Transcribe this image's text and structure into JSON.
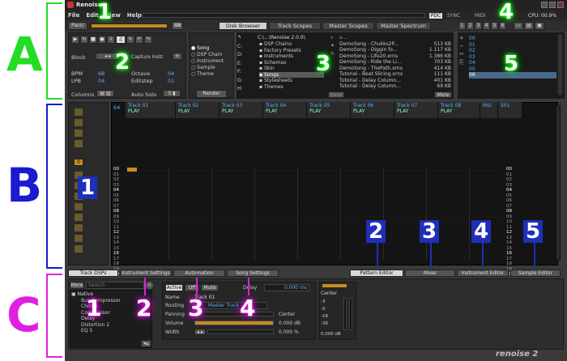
{
  "app": {
    "title": "Renoise",
    "logo": "renoise 2"
  },
  "menu": [
    "File",
    "Edit",
    "View",
    "Help"
  ],
  "status": {
    "pdc": "PDC",
    "sync": "SYNC",
    "midi": "MIDI",
    "cpu": "CPU: 00.9%"
  },
  "toolbar": {
    "panic": "Panic"
  },
  "upper_tabs": [
    "Disk Browser",
    "Track Scopes",
    "Master Scopes",
    "Master Spectrum"
  ],
  "upper_tab_active": "Disk Browser",
  "layout_buttons": [
    "1",
    "2",
    "3",
    "4",
    "5",
    "6"
  ],
  "transport": {
    "block": "Block",
    "capture": "Capture Instr.",
    "bpm_label": "BPM",
    "bpm": "68",
    "lpb_label": "LPB",
    "lpb": "04",
    "octave_label": "Octave",
    "octave": "04",
    "editstep_label": "Editstep",
    "editstep": "01",
    "columns": "Columns",
    "autosolo": "Auto Solo"
  },
  "render": {
    "options": [
      "Song",
      "DSP Chain",
      "Instrument",
      "Sample",
      "Theme"
    ],
    "selected": "Song",
    "button": "Render"
  },
  "browser": {
    "drives": [
      "C:",
      "D:",
      "E:",
      "F:",
      "G:",
      "H:"
    ],
    "path": "C:\\...\\Renoise 2.0.0\\",
    "folders": [
      "DSP Chains",
      "Factory Presets",
      "Instruments",
      "Schemas",
      "Skin",
      "Songs",
      "Stylesheets",
      "Themes"
    ],
    "selected_folder": "Songs",
    "files": [
      {
        "name": "..",
        "size": ""
      },
      {
        "name": "DemoSong - Chukks2P...",
        "size": "513 KB"
      },
      {
        "name": "DemoSong - Diggin fo...",
        "size": "1.117 KB"
      },
      {
        "name": "DemoSong - Life20.xrns",
        "size": "1.386 KB"
      },
      {
        "name": "DemoSong - Ride the Li...",
        "size": "703 KB"
      },
      {
        "name": "DemoSong - ThePath.xrns",
        "size": "414 KB"
      },
      {
        "name": "Tutorial - Beat Slicing.xrns",
        "size": "111 KB"
      },
      {
        "name": "Tutorial - Delay Column...",
        "size": "401 KB"
      },
      {
        "name": "Tutorial - Delay Column...",
        "size": "69 KB"
      }
    ],
    "save": "Save",
    "more": "More"
  },
  "instruments": [
    "00",
    "01",
    "02",
    "03",
    "04",
    "05",
    "06"
  ],
  "sequencer": {
    "current": "0"
  },
  "tracks": [
    "Track 01",
    "Track 02",
    "Track 03",
    "Track 04",
    "Track 05",
    "Track 06",
    "Track 07",
    "Track 08",
    "Mst",
    "S01"
  ],
  "track_play": "PLAY",
  "pattern_number": "64",
  "rows": [
    "00",
    "01",
    "02",
    "03",
    "04",
    "05",
    "06",
    "07",
    "08",
    "09",
    "10",
    "11",
    "12",
    "13",
    "14",
    "15",
    "16",
    "17",
    "18",
    "19",
    "20"
  ],
  "editor_tabs": [
    "Pattern Editor",
    "Mixer",
    "Instrument Editor",
    "Sample Editor"
  ],
  "editor_tab_active": "Pattern Editor",
  "lower_tabs": [
    "Track DSPs",
    "Instrument Settings",
    "Automation",
    "Song Settings"
  ],
  "lower_tab_active": "Track DSPs",
  "dsp": {
    "more": "More",
    "search": "Search",
    "category": "Native",
    "devices": [
      "Bus Compressor",
      "Chorus",
      "Compressor",
      "Delay",
      "Distortion 2",
      "EQ 5"
    ],
    "active": "Active",
    "off": "Off",
    "mute": "Mute",
    "delay_label": "Delay",
    "delay_value": "0.000 ms",
    "name_label": "Name",
    "name_value": "Track 01",
    "routing_label": "Routing",
    "routing_value": "Master Track",
    "panning_label": "Panning",
    "panning_value": "Center",
    "volume_label": "Volume",
    "volume_value": "0.000 dB",
    "width_label": "Width",
    "width_value": "0.000 %",
    "meter_label": "Center",
    "meter_scale": [
      "-3",
      "-9",
      "-18",
      "-36"
    ],
    "meter_db": "0.000 dB"
  },
  "annotations": {
    "sections": [
      "A",
      "B",
      "C"
    ],
    "colors": {
      "A": "#22dd22",
      "B": "#1a1ad0",
      "C": "#e020e0"
    },
    "a_numbers": [
      "1",
      "2",
      "3",
      "4",
      "5"
    ],
    "b_numbers": [
      "1",
      "2",
      "3",
      "4",
      "5"
    ],
    "c_numbers": [
      "1",
      "2",
      "3",
      "4"
    ]
  }
}
